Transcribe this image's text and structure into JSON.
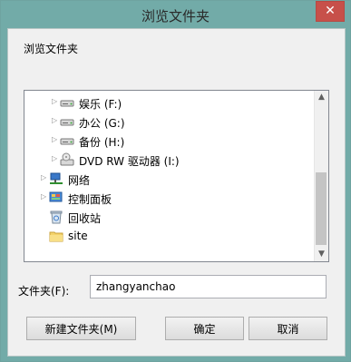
{
  "window": {
    "title": "浏览文件夹",
    "close_label": "✕"
  },
  "description": "浏览文件夹",
  "tree": {
    "items": [
      {
        "label": "娱乐 (F:)",
        "icon": "drive-icon"
      },
      {
        "label": "办公 (G:)",
        "icon": "drive-icon"
      },
      {
        "label": "备份 (H:)",
        "icon": "drive-icon"
      },
      {
        "label": "DVD RW 驱动器 (I:)",
        "icon": "dvd-drive-icon"
      },
      {
        "label": "网络",
        "icon": "network-icon"
      },
      {
        "label": "控制面板",
        "icon": "control-panel-icon"
      },
      {
        "label": "回收站",
        "icon": "recycle-bin-icon"
      },
      {
        "label": "site",
        "icon": "folder-icon"
      }
    ]
  },
  "folder": {
    "label": "文件夹(F):",
    "value": "zhangyanchao"
  },
  "buttons": {
    "new_folder": "新建文件夹(M)",
    "ok": "确定",
    "cancel": "取消"
  }
}
